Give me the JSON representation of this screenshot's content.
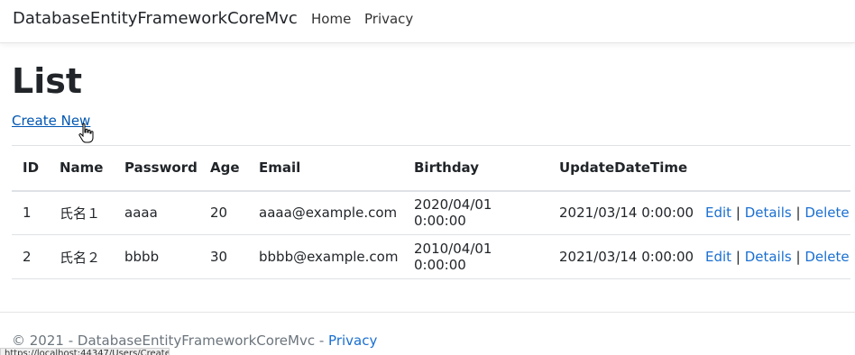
{
  "navbar": {
    "brand": "DatabaseEntityFrameworkCoreMvc",
    "links": [
      {
        "label": "Home"
      },
      {
        "label": "Privacy"
      }
    ]
  },
  "page": {
    "title": "List",
    "create_link": "Create New"
  },
  "table": {
    "headers": [
      "ID",
      "Name",
      "Password",
      "Age",
      "Email",
      "Birthday",
      "UpdateDateTime"
    ],
    "rows": [
      {
        "id": "1",
        "name": "氏名１",
        "password": "aaaa",
        "age": "20",
        "email": "aaaa@example.com",
        "birthday": "2020/04/01 0:00:00",
        "updated": "2021/03/14 0:00:00"
      },
      {
        "id": "2",
        "name": "氏名２",
        "password": "bbbb",
        "age": "30",
        "email": "bbbb@example.com",
        "birthday": "2010/04/01 0:00:00",
        "updated": "2021/03/14 0:00:00"
      }
    ],
    "actions": {
      "edit": "Edit",
      "details": "Details",
      "delete": "Delete",
      "separator": "|"
    }
  },
  "footer": {
    "text": "© 2021 - DatabaseEntityFrameworkCoreMvc - ",
    "privacy_link": "Privacy"
  },
  "status_bar": {
    "url": "https://localhost:44347/Users/Create"
  },
  "colors": {
    "link": "#1a6fd1",
    "text": "#212529",
    "muted": "#6c757d",
    "border": "#dee2e6"
  }
}
